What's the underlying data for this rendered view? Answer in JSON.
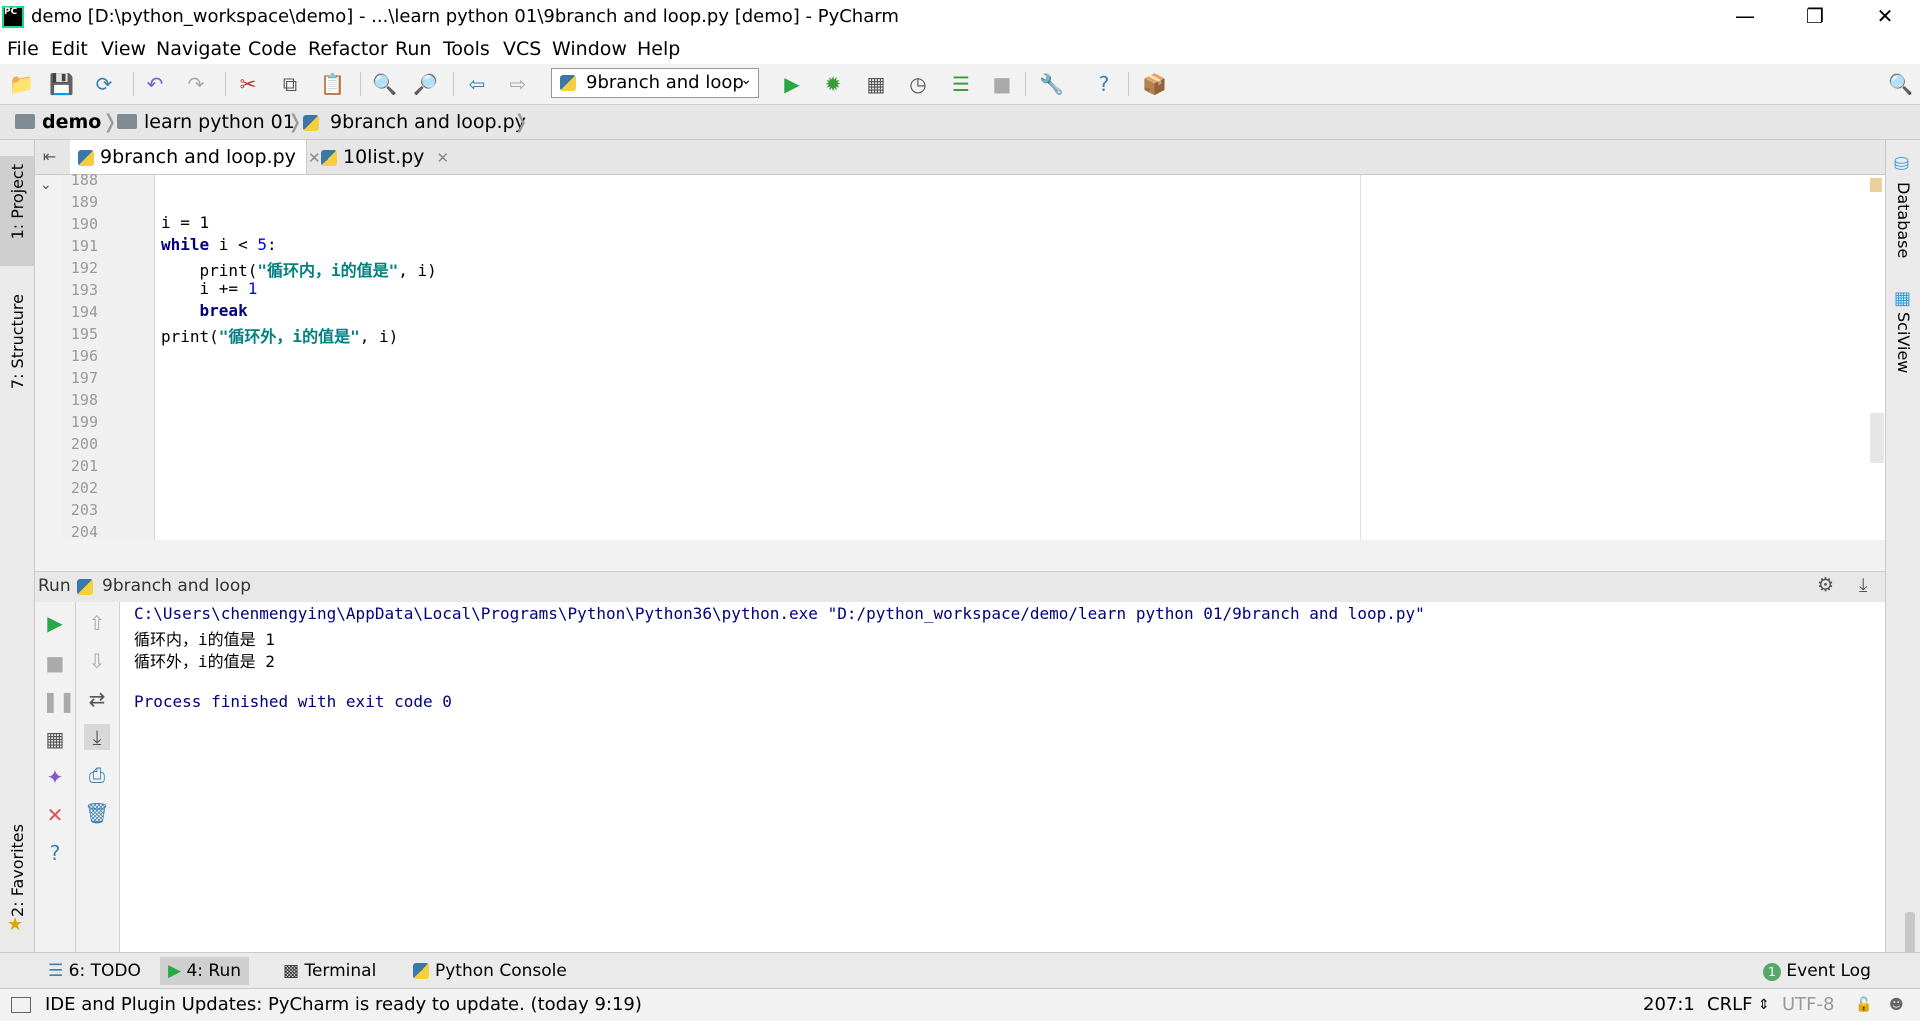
{
  "window": {
    "title": "demo [D:\\python_workspace\\demo] - ...\\learn python 01\\9branch and loop.py [demo] - PyCharm",
    "logo_text": "PC"
  },
  "menu": [
    "File",
    "Edit",
    "View",
    "Navigate",
    "Code",
    "Refactor",
    "Run",
    "Tools",
    "VCS",
    "Window",
    "Help"
  ],
  "toolbar": {
    "run_config": "9branch and loop"
  },
  "breadcrumb": [
    "demo",
    "learn python 01",
    "9branch and loop.py"
  ],
  "editor_tabs": [
    {
      "label": "9branch and loop.py",
      "active": true
    },
    {
      "label": "10list.py",
      "active": false
    }
  ],
  "left_tool_tabs": [
    "1: Project",
    "7: Structure",
    "2: Favorites"
  ],
  "right_tool_tabs": [
    "Database",
    "SciView"
  ],
  "editor": {
    "line_numbers": [
      "188",
      "189",
      "190",
      "191",
      "192",
      "193",
      "194",
      "195",
      "196",
      "197",
      "198",
      "199",
      "200",
      "201",
      "202",
      "203",
      "204"
    ],
    "code": {
      "l190": "i = 1",
      "l191_kw": "while",
      "l191_rest": " i < ",
      "l191_num": "5",
      "l191_end": ":",
      "l192_fn": "    print(",
      "l192_str": "\"循环内，i的值是\"",
      "l192_end": ", i)",
      "l193": "    i += ",
      "l193_num": "1",
      "l194_kw": "    break",
      "l195_fn": "print(",
      "l195_str": "\"循环外，i的值是\"",
      "l195_end": ", i)"
    }
  },
  "run_panel": {
    "label": "Run",
    "config": "9branch and loop",
    "output": [
      "C:\\Users\\chenmengying\\AppData\\Local\\Programs\\Python\\Python36\\python.exe \"D:/python_workspace/demo/learn python 01/9branch and loop.py\"",
      "循环内，i的值是 1",
      "循环外，i的值是 2",
      "",
      "Process finished with exit code 0"
    ]
  },
  "bottom_tabs": [
    {
      "label": "6: TODO"
    },
    {
      "label": "4: Run"
    },
    {
      "label": "Terminal"
    },
    {
      "label": "Python Console"
    }
  ],
  "event_log": {
    "count": "1",
    "label": "Event Log"
  },
  "status": {
    "message": "IDE and Plugin Updates: PyCharm is ready to update. (today 9:19)",
    "position": "207:1",
    "line_sep": "CRLF",
    "encoding": "UTF-8"
  },
  "colors": {
    "accent_green": "#28a745",
    "keyword": "#000080",
    "string": "#008080",
    "number": "#0000ff"
  }
}
